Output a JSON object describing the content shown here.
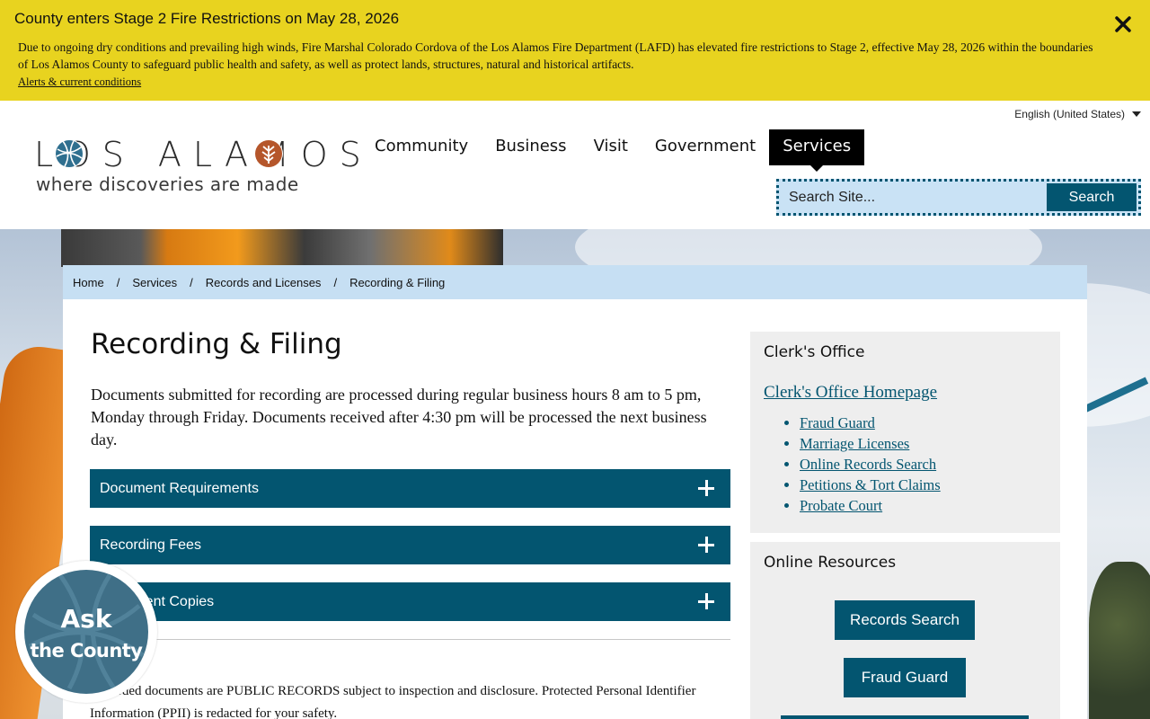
{
  "alert": {
    "title": "County enters Stage 2 Fire Restrictions on May 28, 2026",
    "body": "Due to ongoing dry conditions and prevailing high winds, Fire Marshal Colorado Cordova of the Los Alamos Fire Department (LAFD) has elevated fire restrictions to Stage 2, effective May 28, 2026 within the boundaries of Los Alamos County to safeguard public health and safety, as well as protect lands, structures, natural and historical artifacts.",
    "link": "Alerts & current conditions",
    "close_icon": "close-icon"
  },
  "header": {
    "language": "English (United States)",
    "logo": {
      "word": "LOS ALAMOS",
      "tagline": "where discoveries are made"
    },
    "nav": [
      "Community",
      "Business",
      "Visit",
      "Government",
      "Services"
    ],
    "active_nav": "Services",
    "search": {
      "placeholder": "Search Site...",
      "button": "Search"
    }
  },
  "breadcrumb": [
    "Home",
    "Services",
    "Records and Licenses",
    "Recording & Filing"
  ],
  "main": {
    "title": "Recording & Filing",
    "intro": "Documents submitted for recording are processed during regular business hours 8 am to 5 pm, Monday through Friday. Documents received after 4:30 pm will be processed the next business day.",
    "accordions": [
      "Document Requirements",
      "Recording Fees",
      "Document Copies"
    ],
    "notice": "Recorded documents are PUBLIC RECORDS subject to inspection and disclosure. Protected Personal Identifier Information (PPII) is redacted for your safety."
  },
  "sidebar": {
    "clerk": {
      "heading": "Clerk's Office",
      "homepage": "Clerk's Office Homepage",
      "links": [
        "Fraud Guard",
        "Marriage Licenses",
        "Online Records Search",
        "Petitions & Tort Claims",
        "Probate Court"
      ]
    },
    "resources": {
      "heading": "Online Resources",
      "buttons": [
        "Records Search",
        "Fraud Guard"
      ]
    }
  },
  "ask_widget": {
    "line1": "Ask",
    "line2": "the County"
  },
  "colors": {
    "alert_bg": "#e8d31f",
    "brand_teal": "#035570",
    "breadcrumb_bg": "#c6dff3",
    "sidebar_bg": "#eeeeee"
  }
}
